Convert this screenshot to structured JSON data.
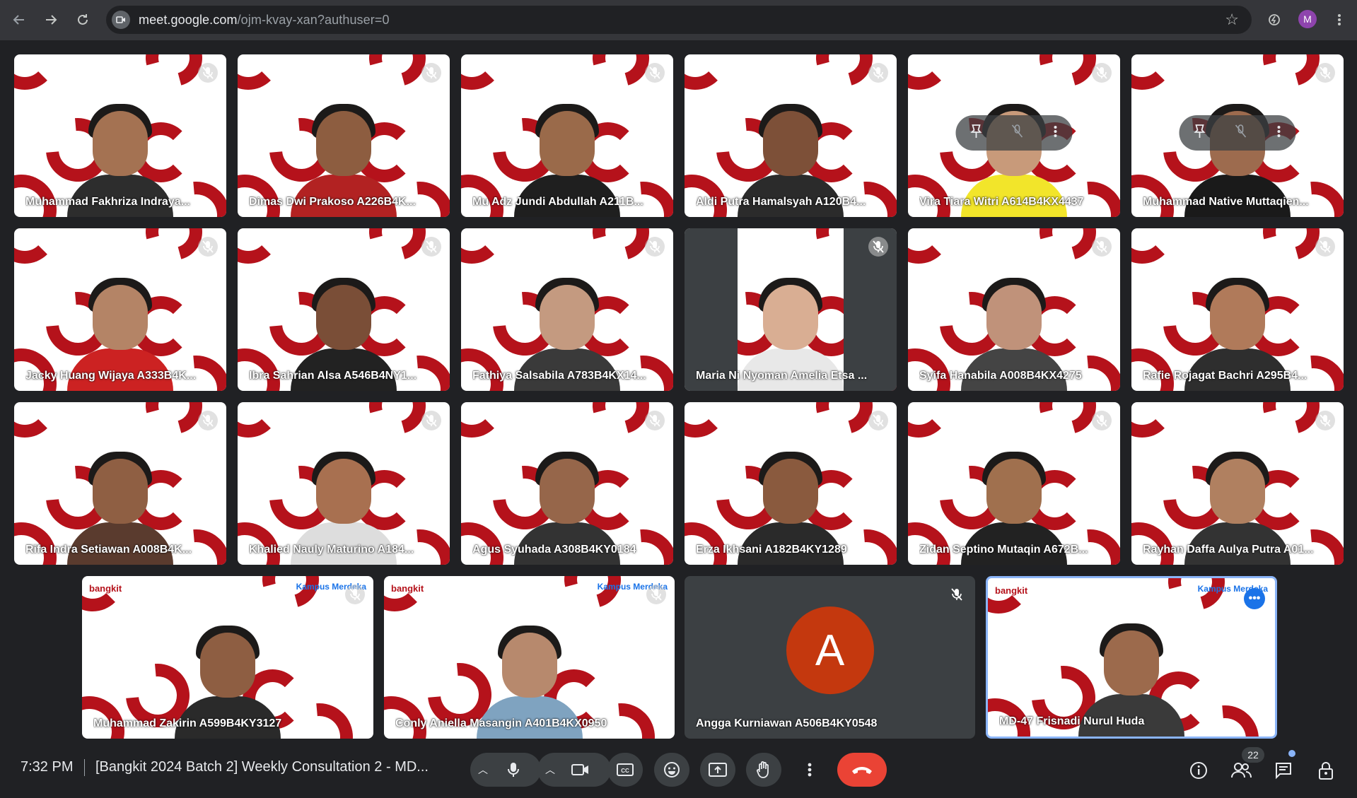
{
  "browser": {
    "url_main": "meet.google.com",
    "url_path": "/ojm-kvay-xan?authuser=0",
    "profile_initial": "M"
  },
  "tiles": [
    {
      "name": "Muhammad Fakhriza Indraya..."
    },
    {
      "name": "Dimas Dwi Prakoso A226B4K..."
    },
    {
      "name": "Mu Adz Jundi Abdullah A211B..."
    },
    {
      "name": "Aldi Putra Hamalsyah A120B4..."
    },
    {
      "name": "Vira Tiara Witri A614B4KX4437"
    },
    {
      "name": "Muhammad Native Muttaqien..."
    },
    {
      "name": "Jacky Huang Wijaya A333B4K..."
    },
    {
      "name": "Ibra Sahrian Alsa A546B4NY1..."
    },
    {
      "name": "Fathiya Salsabila A783B4KX14..."
    },
    {
      "name": "Maria Ni Nyoman Amelia Etsa ..."
    },
    {
      "name": "Syifa Hanabila A008B4KX4275"
    },
    {
      "name": "Rafie Rojagat Bachri A295B4..."
    },
    {
      "name": "Rifa Indra Setiawan A008B4K..."
    },
    {
      "name": "Khalied Nauly Maturino A184..."
    },
    {
      "name": "Agus Syuhada A308B4KY0184"
    },
    {
      "name": "Erza Ikhsani A182B4KY1289"
    },
    {
      "name": "Zidan Septino Mutaqin A672B..."
    },
    {
      "name": "Rayhan Daffa Aulya Putra A01..."
    },
    {
      "name": "Muhammad Zakirin A599B4KY3127"
    },
    {
      "name": "Conly Aniella Masangin A401B4KX0950"
    },
    {
      "name": "Angga Kurniawan A506B4KY0548",
      "avatar_letter": "A"
    },
    {
      "name": "MD-47 Frisnadi Nurul Huda"
    }
  ],
  "brand": {
    "left": "bangkit",
    "right": "Kampus Merdeka"
  },
  "bottom_bar": {
    "time": "7:32 PM",
    "meeting_title": "[Bangkit 2024 Batch 2] Weekly Consultation 2 - MD...",
    "participant_count": "22"
  },
  "colors": {
    "accent": "#8ab4f8",
    "hangup": "#ea4335",
    "brand_red": "#b5121b",
    "avatar": "#c4380e"
  }
}
